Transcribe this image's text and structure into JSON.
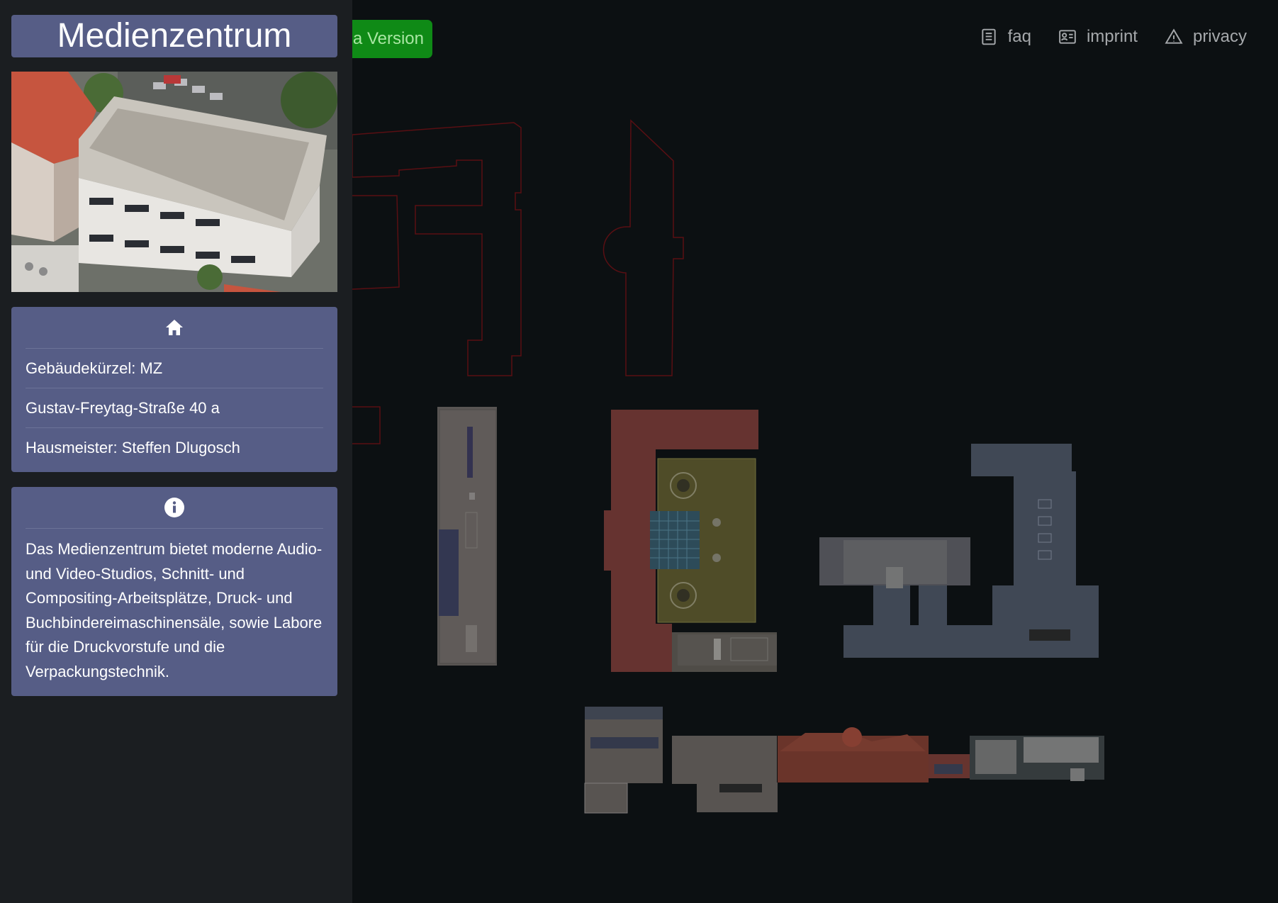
{
  "topbar": {
    "version_button": "na Version",
    "nav": [
      {
        "label": "faq",
        "icon": "document-icon"
      },
      {
        "label": "imprint",
        "icon": "id-card-icon"
      },
      {
        "label": "privacy",
        "icon": "warning-icon"
      }
    ]
  },
  "sidebar": {
    "title": "Medienzentrum",
    "photo_alt": "building-aerial-photo",
    "info_card": {
      "icon": "home-icon",
      "rows": [
        "Gebäudekürzel: MZ",
        "Gustav-Freytag-Straße 40 a",
        "Hausmeister: Steffen Dlugosch"
      ]
    },
    "description_card": {
      "icon": "info-icon",
      "text": "Das Medienzentrum bietet moderne Audio- und Video-Studios, Schnitt- und Compositing-Arbeitsplätze, Druck- und Buchbindereimaschinensäle, sowie Labore für die Druckvorstufe und die Verpackungstechnik."
    }
  },
  "colors": {
    "sidebar_bg": "#1b1e21",
    "card_bg": "#565d86",
    "map_bg": "#0d1013",
    "version_button": "#0f8a16",
    "outline_red": "#6b0f14"
  }
}
